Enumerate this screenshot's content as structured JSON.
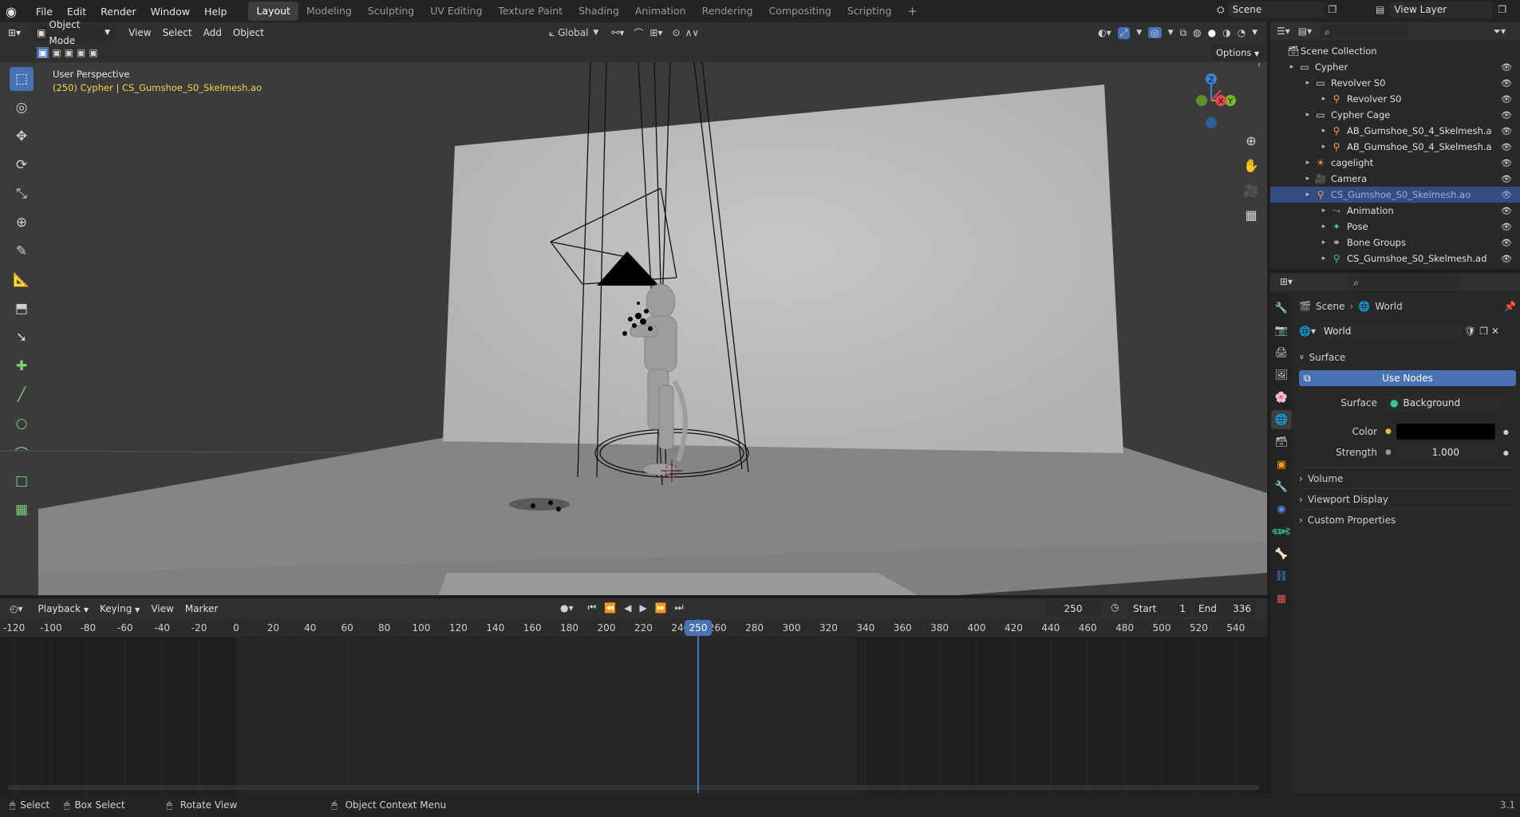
{
  "topbar": {
    "menus": [
      "File",
      "Edit",
      "Render",
      "Window",
      "Help"
    ],
    "workspaces": [
      "Layout",
      "Modeling",
      "Sculpting",
      "UV Editing",
      "Texture Paint",
      "Shading",
      "Animation",
      "Rendering",
      "Compositing",
      "Scripting"
    ],
    "add_tab": "+",
    "scene_name": "Scene",
    "view_layer": "View Layer"
  },
  "viewport": {
    "mode": "Object Mode",
    "menus": [
      "View",
      "Select",
      "Add",
      "Object"
    ],
    "orientation": "Global",
    "options_label": "Options",
    "overlay_title": "User Perspective",
    "overlay_subtitle": "(250) Cypher | CS_Gumshoe_S0_Skelmesh.ao",
    "gizmo": {
      "z": "Z",
      "y": "Y",
      "x": "X"
    }
  },
  "timeline": {
    "menus": [
      "Playback",
      "Keying",
      "View",
      "Marker"
    ],
    "current_frame": "250",
    "start_label": "Start",
    "start_value": "1",
    "end_label": "End",
    "end_value": "336",
    "ticks": [
      "-120",
      "-100",
      "-80",
      "-60",
      "-40",
      "-20",
      "0",
      "20",
      "40",
      "60",
      "80",
      "100",
      "120",
      "140",
      "160",
      "180",
      "200",
      "220",
      "240",
      "260",
      "280",
      "300",
      "320",
      "340",
      "360",
      "380",
      "400",
      "420",
      "440",
      "460",
      "480",
      "500",
      "520",
      "540"
    ],
    "playhead_label": "250"
  },
  "outliner": {
    "root": "Scene Collection",
    "rows": [
      {
        "label": "Cypher",
        "depth": 0,
        "icon": "collection-icon"
      },
      {
        "label": "Revolver S0",
        "depth": 1,
        "icon": "collection-icon"
      },
      {
        "label": "Revolver S0",
        "depth": 2,
        "icon": "armature-icon"
      },
      {
        "label": "Cypher Cage",
        "depth": 1,
        "icon": "collection-icon"
      },
      {
        "label": "AB_Gumshoe_S0_4_Skelmesh.a",
        "depth": 2,
        "icon": "armature-icon"
      },
      {
        "label": "AB_Gumshoe_S0_4_Skelmesh.a",
        "depth": 2,
        "icon": "armature-icon"
      },
      {
        "label": "cagelight",
        "depth": 1,
        "icon": "light-icon"
      },
      {
        "label": "Camera",
        "depth": 1,
        "icon": "camera-icon"
      },
      {
        "label": "CS_Gumshoe_S0_Skelmesh.ao",
        "depth": 1,
        "icon": "armature-icon",
        "selected": true
      },
      {
        "label": "Animation",
        "depth": 2,
        "icon": "animation-icon"
      },
      {
        "label": "Pose",
        "depth": 2,
        "icon": "pose-icon"
      },
      {
        "label": "Bone Groups",
        "depth": 2,
        "icon": "bone-groups-icon"
      },
      {
        "label": "CS_Gumshoe_S0_Skelmesh.ad",
        "depth": 2,
        "icon": "armature-data-icon"
      }
    ]
  },
  "properties": {
    "breadcrumb": [
      "Scene",
      "World"
    ],
    "world_name": "World",
    "surface_panel": "Surface",
    "use_nodes": "Use Nodes",
    "surface_label": "Surface",
    "surface_value": "Background",
    "color_label": "Color",
    "color_value": "#000000",
    "strength_label": "Strength",
    "strength_value": "1.000",
    "collapsed_panels": [
      "Volume",
      "Viewport Display",
      "Custom Properties"
    ]
  },
  "statusbar": {
    "items": [
      "Select",
      "Box Select",
      "Rotate View",
      "Object Context Menu"
    ],
    "version": "3.1"
  },
  "colors": {
    "accent": "#4772b3",
    "selected_row": "#334d80",
    "overlay_yellow": "#f5d54b",
    "axis_x": "#e5484d",
    "axis_y": "#76b82a",
    "axis_z": "#3b82d6"
  }
}
